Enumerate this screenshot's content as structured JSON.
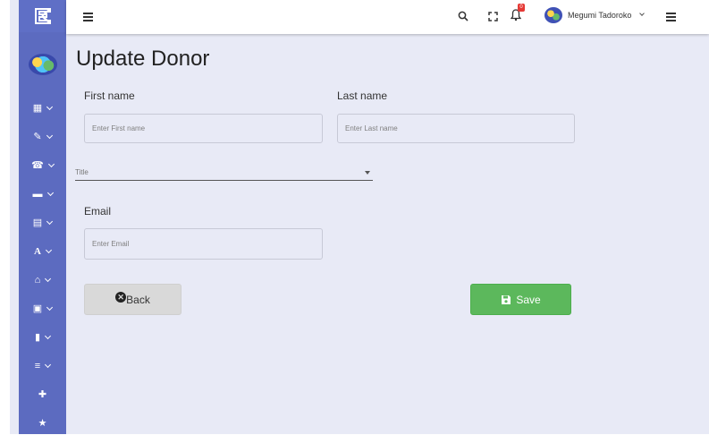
{
  "app": {
    "logo": "ek-logo-icon"
  },
  "sidebar": {
    "items": [
      {
        "icon": "dashboard-icon",
        "glyph": "▦"
      },
      {
        "icon": "pencil-icon",
        "glyph": "✎"
      },
      {
        "icon": "phone-icon",
        "glyph": "☎"
      },
      {
        "icon": "briefcase-icon",
        "glyph": "▬"
      },
      {
        "icon": "calendar-icon",
        "glyph": "▤"
      },
      {
        "icon": "font-icon",
        "glyph": "A"
      },
      {
        "icon": "home-icon",
        "glyph": "⌂"
      },
      {
        "icon": "gift-icon",
        "glyph": "▣"
      },
      {
        "icon": "clipboard-icon",
        "glyph": "▮"
      },
      {
        "icon": "list-icon",
        "glyph": "≡"
      },
      {
        "icon": "medkit-icon",
        "glyph": "✚"
      },
      {
        "icon": "star-icon",
        "glyph": "★"
      }
    ]
  },
  "topbar": {
    "notification_count": "0",
    "user_name": "Megumi Tadoroko"
  },
  "page": {
    "title": "Update Donor"
  },
  "form": {
    "first_name_label": "First name",
    "first_name_placeholder": "Enter First name",
    "last_name_label": "Last name",
    "last_name_placeholder": "Enter Last name",
    "title_placeholder": "Title",
    "email_label": "Email",
    "email_placeholder": "Enter Email"
  },
  "actions": {
    "back_label": "Back",
    "save_label": "Save"
  },
  "colors": {
    "sidebar": "#5c6bc0",
    "background": "#e8eaf6",
    "save": "#5cb85c",
    "badge": "#e53935"
  }
}
